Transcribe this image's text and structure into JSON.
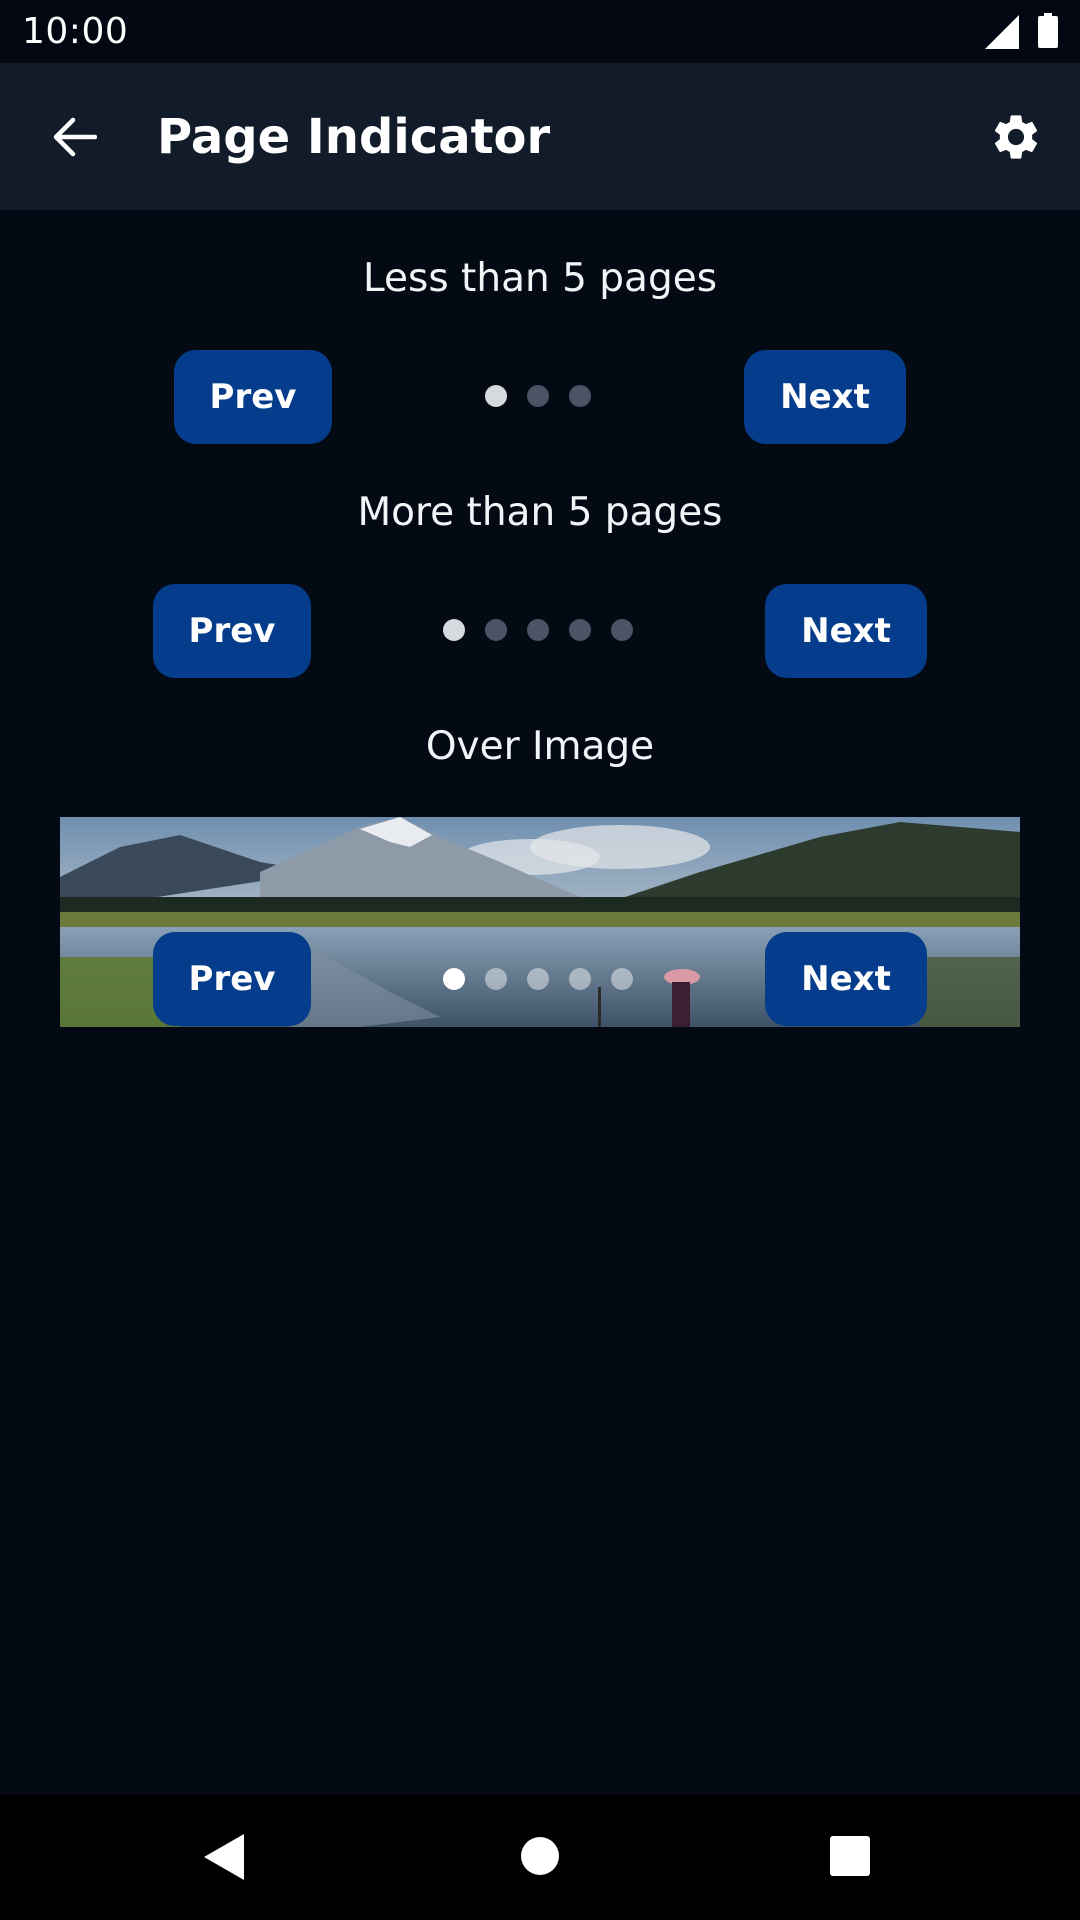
{
  "status_bar": {
    "time": "10:00"
  },
  "app_bar": {
    "title": "Page Indicator"
  },
  "sections": [
    {
      "title": "Less than 5 pages",
      "prev_label": "Prev",
      "next_label": "Next",
      "dot_count": 3,
      "active_index": 0
    },
    {
      "title": "More than 5 pages",
      "prev_label": "Prev",
      "next_label": "Next",
      "dot_count": 5,
      "active_index": 0
    },
    {
      "title": "Over Image",
      "prev_label": "Prev",
      "next_label": "Next",
      "dot_count": 5,
      "active_index": 0
    }
  ],
  "colors": {
    "background": "#040a14",
    "app_bar": "#121b29",
    "button": "#063c8c",
    "dot_active": "#d6d9de",
    "dot_inactive": "#4a5464"
  },
  "icons": [
    "back-arrow-icon",
    "gear-icon",
    "signal-icon",
    "battery-icon",
    "nav-back-icon",
    "nav-home-icon",
    "nav-recents-icon"
  ]
}
